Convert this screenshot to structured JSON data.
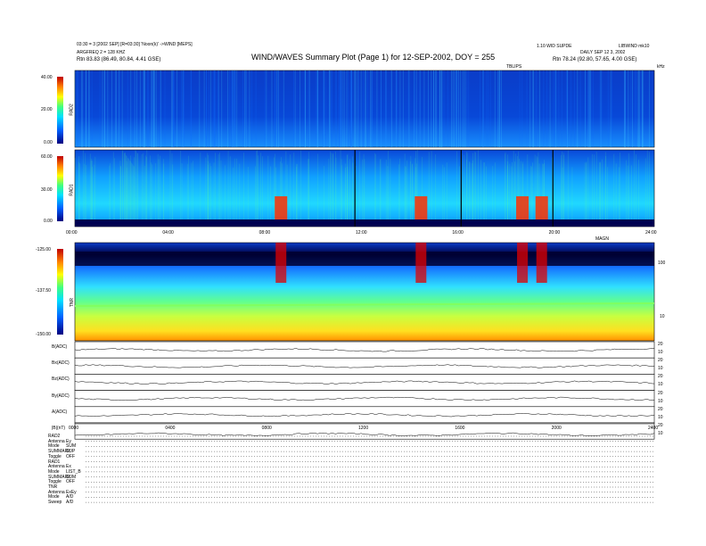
{
  "header": {
    "left_line1": "03:30 = 3 [2002 SEP] [R=03:30] 'Noon(k)' ->WIND [MEPS]",
    "left_line2": "ARGFREQ 2 = 128 KHZ",
    "left_rtn": "Rtn 83.83 (86.49, 80.84, 4.41 GSE)",
    "title": "WIND/WAVES Summary Plot (Page 1) for 12-SEP-2002, DOY = 255",
    "right_line1": "1.10 WID SUPDE",
    "right_line2": "DAILY SEP 12 3, 2002",
    "right_line3": "LIBWIND mk10",
    "right_rtn": "Rtn 78.24 (92.80, 57.65, 4.00 GSE)",
    "tlbl_label": "TBLIPS",
    "top_right_unit": "kHz"
  },
  "colors": {
    "spectrum_low": "#00007f",
    "spectrum_mid": "#00c0ff",
    "spectrum_high": "#ff0000"
  },
  "chart_data": [
    {
      "type": "heatmap",
      "panel": "RAD2",
      "ylabel": "RAD2",
      "colorbar_ticks": [
        "40.00",
        "20.00",
        "0.00"
      ],
      "xlim": [
        "00:00",
        "24:00"
      ]
    },
    {
      "type": "heatmap",
      "panel": "RAD1",
      "ylabel": "RAD1",
      "colorbar_ticks": [
        "60.00",
        "30.00",
        "0.00"
      ],
      "x_tick_labels": [
        "00:00",
        "04:00",
        "08:00",
        "12:00",
        "16:00",
        "20:00",
        "24:00"
      ],
      "bursts_hours": [
        8.5,
        14.3,
        18.5,
        19.3
      ]
    },
    {
      "type": "heatmap",
      "panel": "TNR",
      "ylabel": "TNR",
      "colorbar_ticks": [
        "-125.00",
        "-137.50",
        "-150.00"
      ],
      "right_ticks": [
        "100",
        "10"
      ],
      "header_right": "MAGN"
    },
    {
      "type": "line",
      "panel": "parameters",
      "rows": [
        {
          "label": "B(ADC)",
          "right": [
            "20",
            "10"
          ]
        },
        {
          "label": "Bx(ADC)",
          "right": [
            "20",
            "10"
          ]
        },
        {
          "label": "Bz(ADC)",
          "right": [
            "20",
            "10"
          ]
        },
        {
          "label": "By(ADC)",
          "right": [
            "20",
            "10"
          ]
        },
        {
          "label": "A(ADC)",
          "right": [
            "20",
            "10"
          ]
        },
        {
          "label": "|B|(nT)",
          "right": [
            "20",
            "10"
          ]
        }
      ],
      "x_tick_labels": [
        "0000",
        "0400",
        "0800",
        "1200",
        "1600",
        "2000",
        "2400"
      ]
    }
  ],
  "footer": [
    {
      "label": "RAD2"
    },
    {
      "label": "Antenna",
      "value": "Ey"
    },
    {
      "label": "Mode",
      "value": "SUM"
    },
    {
      "label": "SUMMARY",
      "value": "SUP"
    },
    {
      "label": "Toggle",
      "value": "OFF"
    },
    {
      "label": "RAD1"
    },
    {
      "label": "Antenna",
      "value": "Ex"
    },
    {
      "label": "Mode",
      "value": "LIST_B"
    },
    {
      "label": "SUMMARY",
      "value": "SUM"
    },
    {
      "label": "Toggle",
      "value": "OFF"
    },
    {
      "label": "TNR"
    },
    {
      "label": "Antenna",
      "value": "ExEy"
    },
    {
      "label": "Mode",
      "value": "A/D"
    },
    {
      "label": "Sweep",
      "value": "A/D"
    }
  ]
}
